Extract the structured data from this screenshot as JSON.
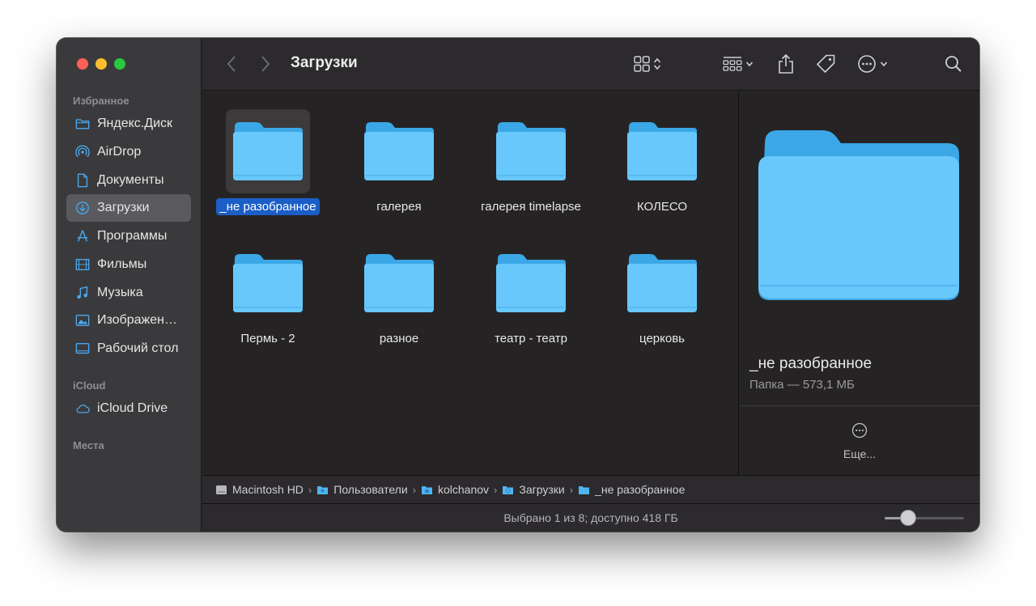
{
  "window": {
    "title": "Загрузки"
  },
  "sidebar": {
    "favorites_title": "Избранное",
    "favorites": [
      {
        "label": "Яндекс.Диск",
        "icon": "folder-outline-icon"
      },
      {
        "label": "AirDrop",
        "icon": "airdrop-icon"
      },
      {
        "label": "Документы",
        "icon": "document-icon"
      },
      {
        "label": "Загрузки",
        "icon": "download-icon",
        "active": true
      },
      {
        "label": "Программы",
        "icon": "apps-icon"
      },
      {
        "label": "Фильмы",
        "icon": "film-icon"
      },
      {
        "label": "Музыка",
        "icon": "music-icon"
      },
      {
        "label": "Изображен…",
        "icon": "photo-icon"
      },
      {
        "label": "Рабочий стол",
        "icon": "desktop-icon"
      }
    ],
    "icloud_title": "iCloud",
    "icloud": [
      {
        "label": "iCloud Drive",
        "icon": "cloud-icon"
      }
    ],
    "places_title": "Места"
  },
  "files": [
    {
      "name": "_не разобранное",
      "selected": true
    },
    {
      "name": "галерея"
    },
    {
      "name": "галерея timelapse"
    },
    {
      "name": "КОЛЕСО"
    },
    {
      "name": "Пермь - 2"
    },
    {
      "name": "разное"
    },
    {
      "name": "театр - театр"
    },
    {
      "name": "церковь"
    }
  ],
  "preview": {
    "name": "_не разобранное",
    "info": "Папка — 573,1 МБ",
    "more_label": "Еще..."
  },
  "pathbar": [
    {
      "label": "Macintosh HD",
      "icon": "disk-icon"
    },
    {
      "label": "Пользователи",
      "icon": "folder-icon"
    },
    {
      "label": "kolchanov",
      "icon": "home-folder-icon"
    },
    {
      "label": "Загрузки",
      "icon": "downloads-folder-icon"
    },
    {
      "label": "_не разобранное",
      "icon": "folder-icon"
    }
  ],
  "status": {
    "text": "Выбрано 1 из 8; доступно 418 ГБ",
    "icon_size": 0.3
  },
  "colors": {
    "folder_light": "#68c8fb",
    "folder_dark": "#3ba7e6",
    "selection": "#1c5ec7"
  }
}
